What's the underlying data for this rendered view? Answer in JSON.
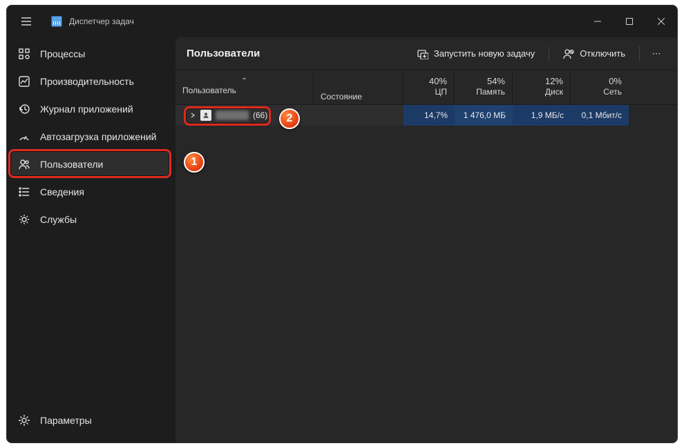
{
  "app": {
    "title": "Диспетчер задач"
  },
  "sidebar": {
    "items": [
      {
        "key": "processes",
        "label": "Процессы"
      },
      {
        "key": "performance",
        "label": "Производительность"
      },
      {
        "key": "apphistory",
        "label": "Журнал приложений"
      },
      {
        "key": "startup",
        "label": "Автозагрузка приложений"
      },
      {
        "key": "users",
        "label": "Пользователи"
      },
      {
        "key": "details",
        "label": "Сведения"
      },
      {
        "key": "services",
        "label": "Службы"
      }
    ],
    "settings_label": "Параметры"
  },
  "page": {
    "title": "Пользователи",
    "actions": {
      "run_task": "Запустить новую задачу",
      "disconnect": "Отключить",
      "more": "⋯"
    }
  },
  "columns": {
    "user": "Пользователь",
    "state": "Состояние",
    "cpu": {
      "pct": "40%",
      "label": "ЦП"
    },
    "mem": {
      "pct": "54%",
      "label": "Память"
    },
    "disk": {
      "pct": "12%",
      "label": "Диск"
    },
    "net": {
      "pct": "0%",
      "label": "Сеть"
    }
  },
  "rows": [
    {
      "suffix": "(66)",
      "cpu": "14,7%",
      "mem": "1 476,0 МБ",
      "disk": "1,9 МБ/с",
      "net": "0,1 Мбит/с"
    }
  ],
  "annotations": {
    "b1": "1",
    "b2": "2"
  }
}
